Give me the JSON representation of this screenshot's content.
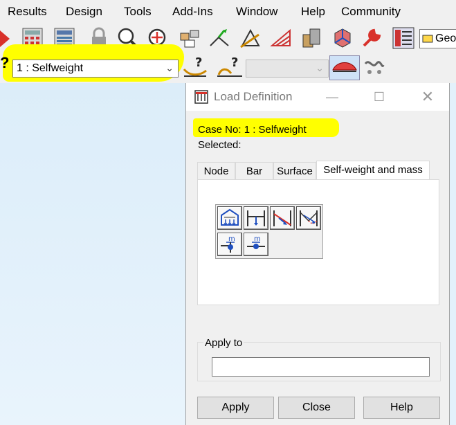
{
  "menubar": {
    "items": [
      "Results",
      "Design",
      "Tools",
      "Add-Ins",
      "Window",
      "Help",
      "Community"
    ]
  },
  "toolbar": {
    "geometry_combo_text": "Geo",
    "load_case_value": "1 : Selfweight",
    "help_mark_1": "?",
    "help_mark_2": "?"
  },
  "dialog": {
    "title": "Load Definition",
    "case_label": "Case No: 1 : Selfweight",
    "selected_label": "Selected:",
    "tabs": [
      "Node",
      "Bar",
      "Surface",
      "Self-weight and mass"
    ],
    "active_tab": "Self-weight and mass",
    "mass_label_1": "m",
    "mass_label_2": "m",
    "apply_to_label": "Apply to",
    "apply_to_value": "",
    "buttons": {
      "apply": "Apply",
      "close": "Close",
      "help": "Help"
    }
  },
  "colors": {
    "highlight": "#ffff00",
    "workspace": "#e3f1fb",
    "menubar": "#f0f0f0",
    "icon_blue": "#1f4fbf",
    "icon_red": "#d8312a"
  }
}
